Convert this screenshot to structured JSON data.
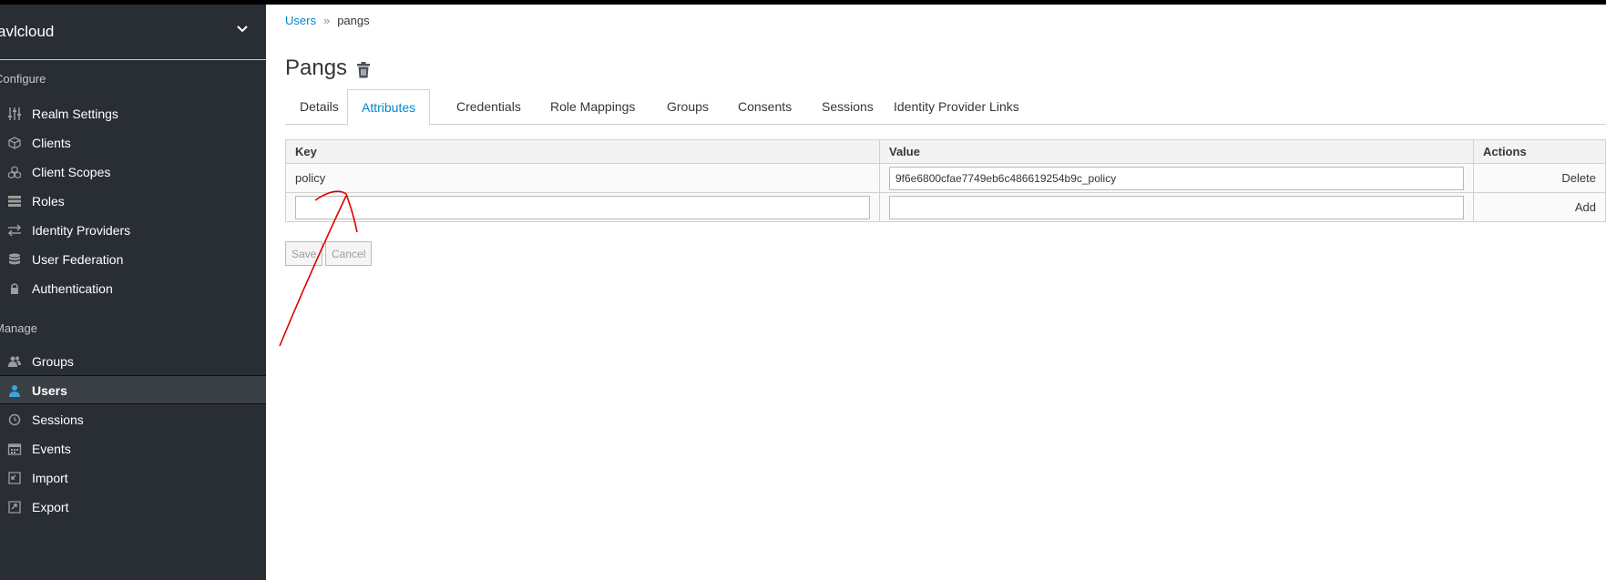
{
  "sidebar": {
    "realm_name": "avlcloud",
    "configure_label": "Configure",
    "manage_label": "Manage",
    "configure_items": [
      {
        "label": "Realm Settings",
        "icon": "sliders-icon"
      },
      {
        "label": "Clients",
        "icon": "cube-icon"
      },
      {
        "label": "Client Scopes",
        "icon": "cubes-icon"
      },
      {
        "label": "Roles",
        "icon": "list-icon"
      },
      {
        "label": "Identity Providers",
        "icon": "exchange-icon"
      },
      {
        "label": "User Federation",
        "icon": "database-icon"
      },
      {
        "label": "Authentication",
        "icon": "lock-icon"
      }
    ],
    "manage_items": [
      {
        "label": "Groups",
        "icon": "users-icon"
      },
      {
        "label": "Users",
        "icon": "user-icon",
        "active": true
      },
      {
        "label": "Sessions",
        "icon": "clock-icon"
      },
      {
        "label": "Events",
        "icon": "calendar-icon"
      },
      {
        "label": "Import",
        "icon": "import-icon"
      },
      {
        "label": "Export",
        "icon": "export-icon"
      }
    ]
  },
  "breadcrumb": {
    "parent": "Users",
    "separator": "»",
    "current": "pangs"
  },
  "page": {
    "title": "Pangs"
  },
  "tabs": [
    {
      "label": "Details"
    },
    {
      "label": "Attributes",
      "active": true
    },
    {
      "label": "Credentials"
    },
    {
      "label": "Role Mappings"
    },
    {
      "label": "Groups"
    },
    {
      "label": "Consents"
    },
    {
      "label": "Sessions"
    },
    {
      "label": "Identity Provider Links"
    }
  ],
  "attributes": {
    "headers": {
      "key": "Key",
      "value": "Value",
      "actions": "Actions"
    },
    "rows": [
      {
        "key": "policy",
        "value": "9f6e6800cfae7749eb6c486619254b9c_policy",
        "action": "Delete"
      }
    ],
    "new_row": {
      "key": "",
      "value": "",
      "action": "Add"
    }
  },
  "buttons": {
    "save": "Save",
    "cancel": "Cancel"
  },
  "colors": {
    "sidebar_bg": "#292e34",
    "accent": "#0088ce",
    "annotation": "#e00000"
  }
}
